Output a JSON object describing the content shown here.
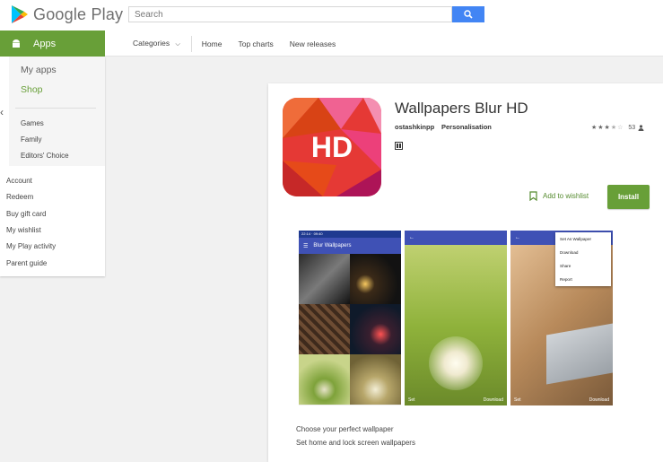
{
  "header": {
    "logo_text": "Google Play",
    "search": {
      "placeholder": "Search"
    }
  },
  "subnav": {
    "apps_label": "Apps",
    "categories_label": "Categories",
    "links": [
      "Home",
      "Top charts",
      "New releases"
    ]
  },
  "sidebar": {
    "top_items": [
      "My apps",
      "Shop"
    ],
    "category_items": [
      "Games",
      "Family",
      "Editors' Choice"
    ],
    "account_items": [
      "Account",
      "Redeem",
      "Buy gift card",
      "My wishlist",
      "My Play activity",
      "Parent guide"
    ]
  },
  "app": {
    "icon_text": "HD",
    "title": "Wallpapers Blur HD",
    "developer": "ostashkinpp",
    "category": "Personalisation",
    "rating_count": "53",
    "rating_value": 3.5,
    "wishlist_label": "Add to wishlist",
    "install_label": "Install",
    "description": [
      "Choose your perfect wallpaper",
      "Set home and lock screen wallpapers"
    ]
  },
  "screenshots": {
    "status_time": "22:14 · 09:40",
    "app_bar_title": "Blur Wallpapers",
    "set_label": "Set",
    "download_label": "Download",
    "menu_items": [
      "Set As Wallpaper",
      "Download",
      "Share",
      "Report"
    ]
  },
  "colors": {
    "brand_green": "#689f38",
    "search_blue": "#4285f4",
    "app_bar": "#3f51b5"
  }
}
